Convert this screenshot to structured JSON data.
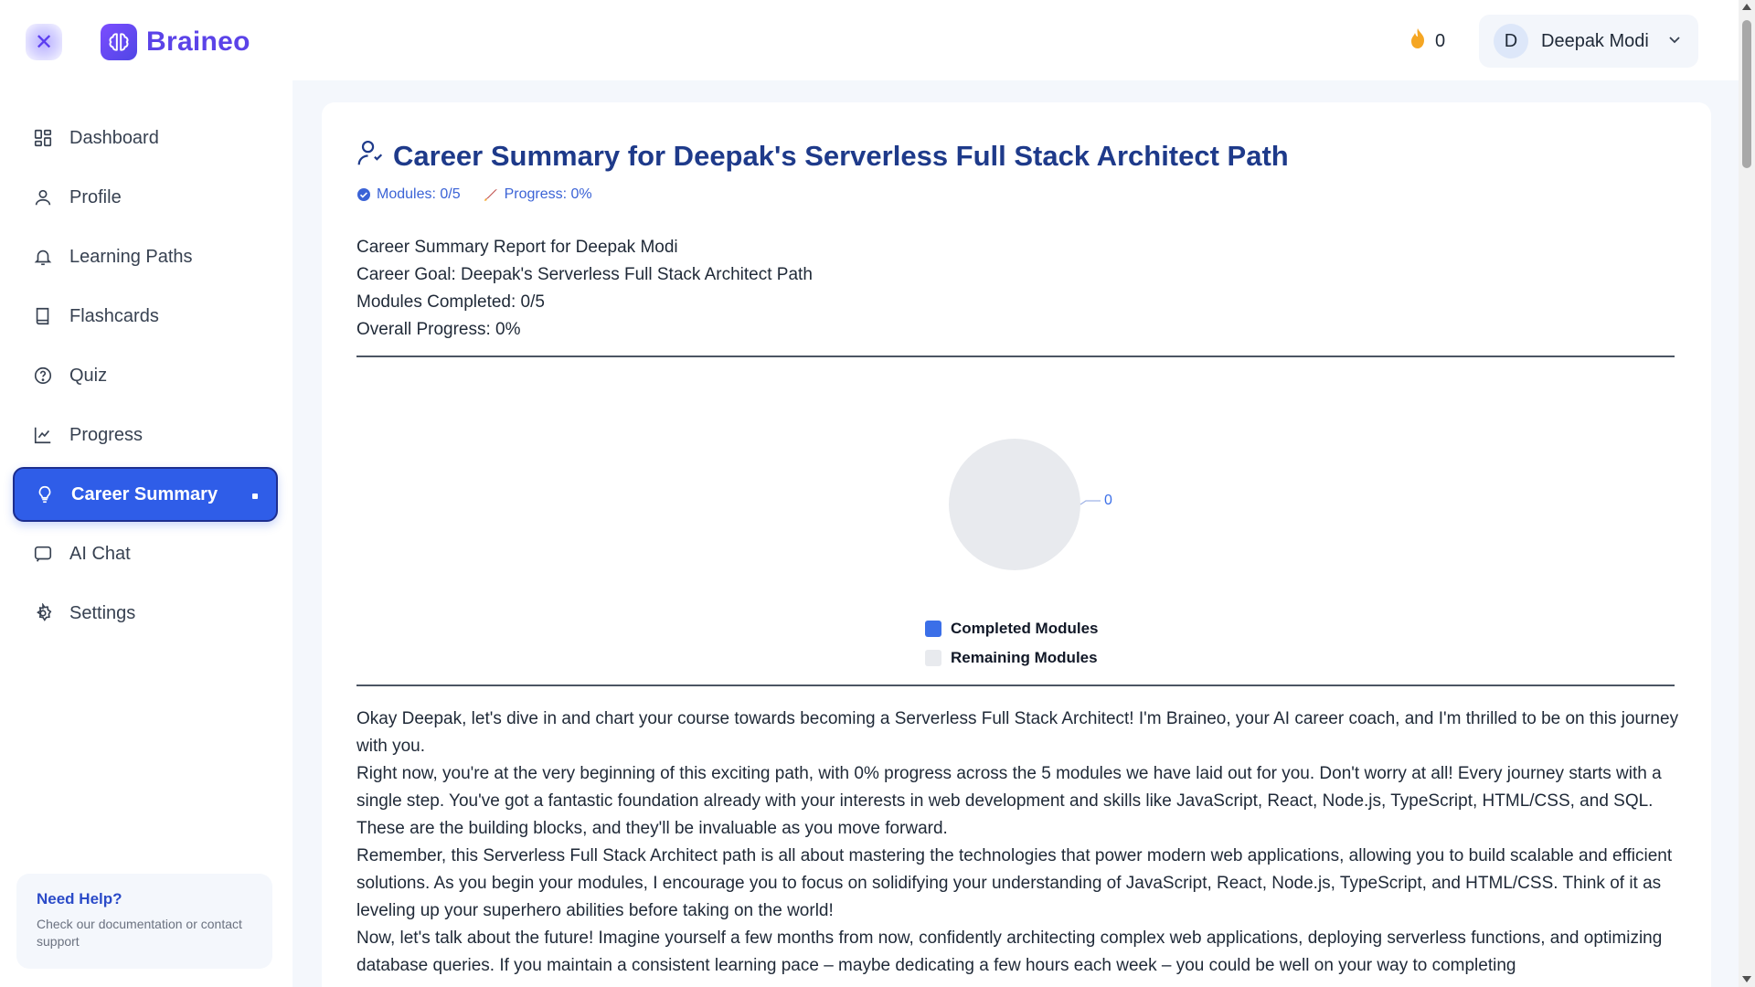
{
  "app": {
    "name": "Braineo",
    "close_icon": "close-icon",
    "logo_icon": "brain-icon"
  },
  "header": {
    "streak_icon": "flame-icon",
    "streak_count": "0",
    "user": {
      "initial": "D",
      "name": "Deepak Modi"
    }
  },
  "sidebar": {
    "items": [
      {
        "label": "Dashboard",
        "icon": "dashboard-icon"
      },
      {
        "label": "Profile",
        "icon": "user-icon"
      },
      {
        "label": "Learning Paths",
        "icon": "bell-icon"
      },
      {
        "label": "Flashcards",
        "icon": "book-icon"
      },
      {
        "label": "Quiz",
        "icon": "help-circle-icon"
      },
      {
        "label": "Progress",
        "icon": "chart-line-icon"
      },
      {
        "label": "Career Summary",
        "icon": "lightbulb-icon",
        "active": true
      },
      {
        "label": "AI Chat",
        "icon": "chat-icon"
      },
      {
        "label": "Settings",
        "icon": "gear-icon"
      }
    ],
    "help": {
      "title": "Need Help?",
      "text": "Check our documentation or contact support"
    }
  },
  "main": {
    "title": "Career Summary for Deepak's Serverless Full Stack Architect Path",
    "modules_meta": "Modules: 0/5",
    "progress_meta": "Progress: 0%",
    "summary": {
      "line1": "Career Summary Report for Deepak Modi",
      "line2": "Career Goal: Deepak's Serverless Full Stack Architect Path",
      "line3": "Modules Completed: 0/5",
      "line4": "Overall Progress: 0%"
    },
    "paragraphs": [
      "Okay Deepak, let's dive in and chart your course towards becoming a Serverless Full Stack Architect! I'm Braineo, your AI career coach, and I'm thrilled to be on this journey with you.",
      "Right now, you're at the very beginning of this exciting path, with 0% progress across the 5 modules we have laid out for you. Don't worry at all! Every journey starts with a single step. You've got a fantastic foundation already with your interests in web development and skills like JavaScript, React, Node.js, TypeScript, HTML/CSS, and SQL. These are the building blocks, and they'll be invaluable as you move forward.",
      "Remember, this Serverless Full Stack Architect path is all about mastering the technologies that power modern web applications, allowing you to build scalable and efficient solutions. As you begin your modules, I encourage you to focus on solidifying your understanding of JavaScript, React, Node.js, TypeScript, and HTML/CSS. Think of it as leveling up your superhero abilities before taking on the world!",
      "Now, let's talk about the future! Imagine yourself a few months from now, confidently architecting complex web applications, deploying serverless functions, and optimizing database queries. If you maintain a consistent learning pace – maybe dedicating a few hours each week – you could be well on your way to completing"
    ]
  },
  "chart_data": {
    "type": "pie",
    "categories": [
      "Completed Modules",
      "Remaining Modules"
    ],
    "values": [
      0,
      0
    ],
    "slice_label": "0",
    "colors": [
      "#3b6fe8",
      "#e8eaee"
    ],
    "legend_position": "bottom"
  },
  "colors": {
    "accent": "#2f5de8",
    "title": "#1e3a8a",
    "brand": "#5b43e8"
  }
}
